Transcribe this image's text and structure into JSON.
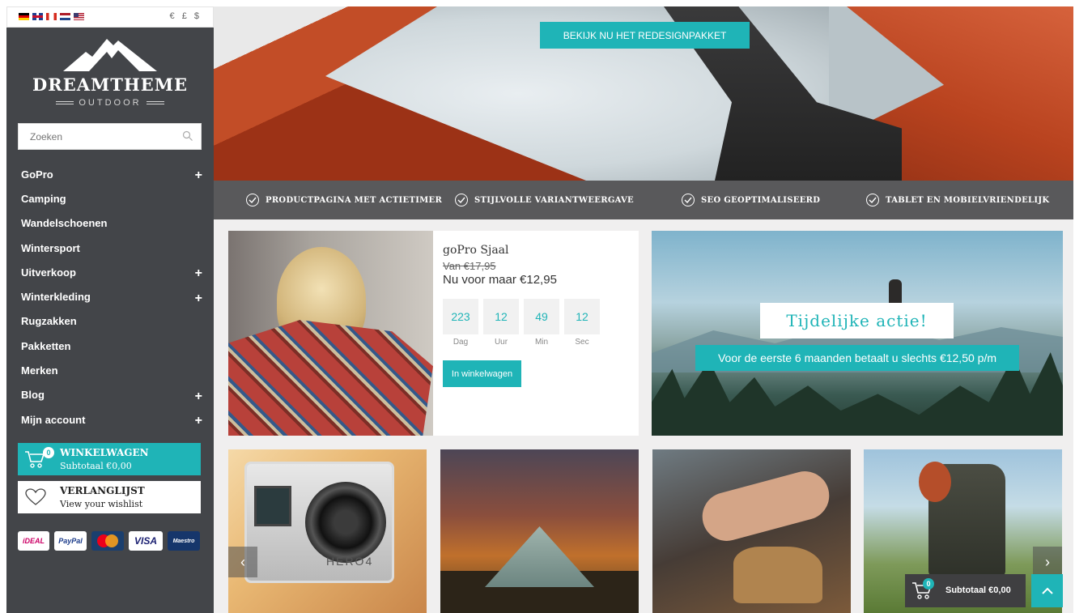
{
  "topbar": {
    "flags": [
      "de",
      "gb",
      "ca",
      "nl",
      "us"
    ],
    "currencies": "€ £ $"
  },
  "logo": {
    "name": "DREAMTHEME",
    "sub": "OUTDOOR"
  },
  "search": {
    "placeholder": "Zoeken"
  },
  "nav": {
    "items": [
      {
        "label": "GoPro",
        "expandable": true
      },
      {
        "label": "Camping",
        "expandable": false
      },
      {
        "label": "Wandelschoenen",
        "expandable": false
      },
      {
        "label": "Wintersport",
        "expandable": false
      },
      {
        "label": "Uitverkoop",
        "expandable": true
      },
      {
        "label": "Winterkleding",
        "expandable": true
      },
      {
        "label": "Rugzakken",
        "expandable": false
      },
      {
        "label": "Pakketten",
        "expandable": false
      },
      {
        "label": "Merken",
        "expandable": false
      },
      {
        "label": "Blog",
        "expandable": true
      },
      {
        "label": "Mijn account",
        "expandable": true
      }
    ],
    "plus": "+"
  },
  "cart": {
    "count": "0",
    "title": "WINKELWAGEN",
    "subtotal": "Subtotaal €0,00"
  },
  "wishlist": {
    "title": "VERLANGLIJST",
    "sub": "View your wishlist"
  },
  "payments": {
    "ideal": "iDEAL",
    "paypal": "PayPal",
    "visa": "VISA",
    "maestro": "Maestro"
  },
  "hero": {
    "button": "BEKIJK NU HET REDESIGNPAKKET"
  },
  "features": [
    "PRODUCTPAGINA MET ACTIETIMER",
    "STIJLVOLLE VARIANTWEERGAVE",
    "SEO GEOPTIMALISEERD",
    "TABLET EN MOBIELVRIENDELIJK"
  ],
  "product": {
    "name": "goPro Sjaal",
    "old_price": "Van €17,95",
    "new_price": "Nu voor maar €12,95",
    "timer": [
      {
        "value": "223",
        "label": "Dag"
      },
      {
        "value": "12",
        "label": "Uur"
      },
      {
        "value": "49",
        "label": "Min"
      },
      {
        "value": "12",
        "label": "Sec"
      }
    ],
    "add_button": "In winkelwagen"
  },
  "promo": {
    "title": "Tijdelijke actie!",
    "subtitle": "Voor de eerste 6 maanden betaalt u slechts €12,50 p/m"
  },
  "tiles": {
    "camera_brand": "HERO4"
  },
  "carousel": {
    "prev": "‹",
    "next": "›"
  },
  "float_cart": {
    "count": "0",
    "subtotal": "Subtotaal €0,00"
  },
  "colors": {
    "accent": "#1fb4b7",
    "sidebar": "#434549",
    "features_bar": "#59595b"
  }
}
